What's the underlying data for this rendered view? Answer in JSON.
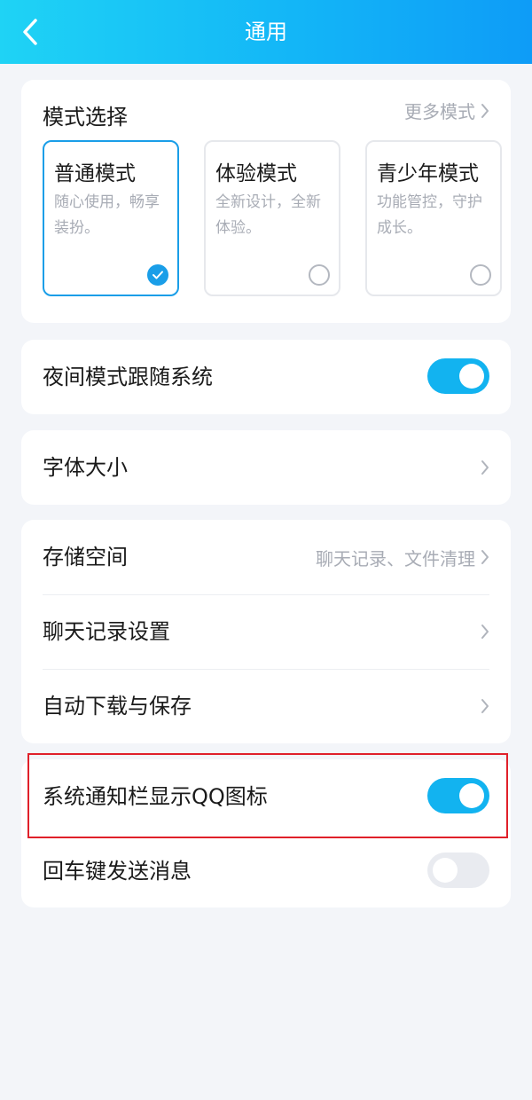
{
  "header": {
    "title": "通用"
  },
  "mode_section": {
    "title": "模式选择",
    "more_link": "更多模式",
    "modes": [
      {
        "name": "普通模式",
        "desc": "随心使用，畅享装扮。",
        "selected": true
      },
      {
        "name": "体验模式",
        "desc": "全新设计，全新体验。",
        "selected": false
      },
      {
        "name": "青少年模式",
        "desc": "功能管控，守护成长。",
        "selected": false
      }
    ]
  },
  "night_mode": {
    "label": "夜间模式跟随系统",
    "enabled": true
  },
  "font_size": {
    "label": "字体大小"
  },
  "storage_group": {
    "storage": {
      "label": "存储空间",
      "value": "聊天记录、文件清理"
    },
    "chat_settings": {
      "label": "聊天记录设置"
    },
    "auto_download": {
      "label": "自动下载与保存"
    }
  },
  "toggles_group": {
    "notification_icon": {
      "label": "系统通知栏显示QQ图标",
      "enabled": true
    },
    "enter_to_send": {
      "label": "回车键发送消息",
      "enabled": false
    }
  },
  "colors": {
    "accent": "#1a9ee8",
    "toggle_on": "#12b3f0",
    "highlight_border": "#e0202a"
  }
}
